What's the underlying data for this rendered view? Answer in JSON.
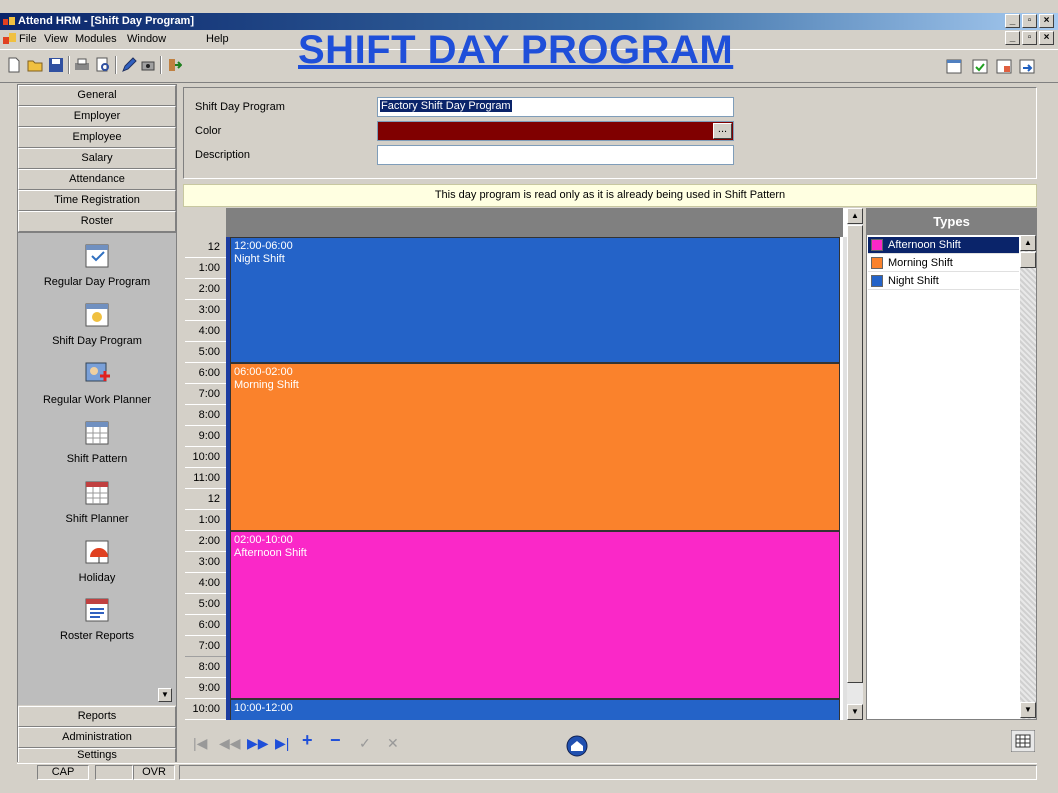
{
  "window": {
    "title": "Attend HRM - [Shift Day Program]",
    "buttons": [
      "_",
      "̅̅□",
      "X"
    ]
  },
  "menu": {
    "items": [
      "File",
      "View",
      "Modules",
      "Window",
      "Help"
    ]
  },
  "page_heading": "SHIFT DAY PROGRAM",
  "sidebar": {
    "sections_top": [
      "General",
      "Employer",
      "Employee",
      "Salary",
      "Attendance",
      "Time Registration",
      "Roster"
    ],
    "items": [
      "Regular Day Program",
      "Shift Day Program",
      "Regular Work Planner",
      "Shift Pattern",
      "Shift Planner",
      "Holiday",
      "Roster Reports"
    ],
    "sections_bottom": [
      "Reports",
      "Administration",
      "Settings"
    ]
  },
  "form": {
    "shift_day_program_label": "Shift Day Program",
    "shift_day_program_value": "Factory Shift Day Program",
    "color_label": "Color",
    "color_value": "#800000",
    "color_button": "...",
    "description_label": "Description",
    "description_value": ""
  },
  "notice": "This day program is read only as it is already being used in Shift Pattern",
  "schedule": {
    "time_ticks": [
      "12",
      "1:00",
      "2:00",
      "3:00",
      "4:00",
      "5:00",
      "6:00",
      "7:00",
      "8:00",
      "9:00",
      "10:00",
      "11:00",
      "12",
      "1:00",
      "2:00",
      "3:00",
      "4:00",
      "5:00",
      "6:00",
      "7:00",
      "8:00",
      "9:00",
      "10:00"
    ],
    "blocks": [
      {
        "time": "12:00-06:00",
        "name": "Night Shift",
        "color": "#2463c8"
      },
      {
        "time": "06:00-02:00",
        "name": "Morning Shift",
        "color": "#fa822c"
      },
      {
        "time": "02:00-10:00",
        "name": "Afternoon Shift",
        "color": "#fa28c8"
      },
      {
        "time": "10:00-12:00",
        "name": "",
        "color": "#2463c8"
      }
    ]
  },
  "types": {
    "header": "Types",
    "items": [
      {
        "name": "Afternoon Shift",
        "color": "#fa28c8",
        "selected": true
      },
      {
        "name": "Morning Shift",
        "color": "#fa822c",
        "selected": false
      },
      {
        "name": "Night Shift",
        "color": "#2463c8",
        "selected": false
      }
    ]
  },
  "record_nav": {
    "buttons": [
      "|◀",
      "◀◀",
      "▶▶",
      "▶|",
      "+",
      "−",
      "✓",
      "✕"
    ]
  },
  "statusbar": {
    "panels": [
      "CAP",
      "OVR"
    ]
  }
}
